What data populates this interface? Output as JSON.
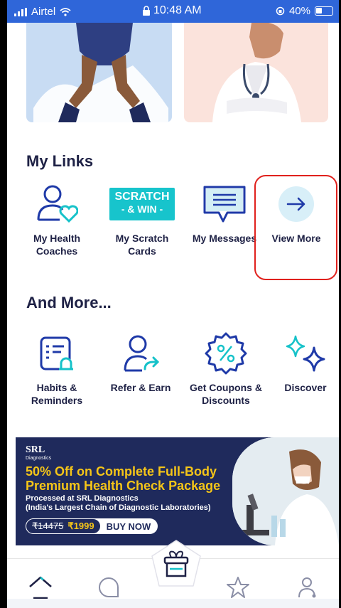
{
  "status_bar": {
    "carrier": "Airtel",
    "time": "10:48 AM",
    "battery": "40%"
  },
  "my_links": {
    "title": "My Links",
    "items": [
      {
        "label": "My Health Coaches",
        "icon": "person-heart-icon"
      },
      {
        "label": "My Scratch Cards",
        "icon": "scratch-win-icon",
        "badge_line1": "SCRATCH",
        "badge_line2": "- & WIN -"
      },
      {
        "label": "My Messages",
        "icon": "message-icon"
      },
      {
        "label": "View More",
        "icon": "arrow-right-icon"
      }
    ]
  },
  "and_more": {
    "title": "And More...",
    "items": [
      {
        "label": "Habits & Reminders",
        "icon": "habit-reminder-icon"
      },
      {
        "label": "Refer & Earn",
        "icon": "refer-user-icon"
      },
      {
        "label": "Get Coupons & Discounts",
        "icon": "coupon-percent-icon"
      },
      {
        "label": "Discover",
        "icon": "sparkle-icon"
      }
    ]
  },
  "ad": {
    "brand": "SRL",
    "brand_sub": "Diagnostics",
    "headline": "50% Off on Complete Full-Body Premium Health Check Package",
    "sub1": "Processed at SRL Diagnostics",
    "sub2": "(India's Largest Chain of Diagnostic Laboratories)",
    "old_price": "₹14475",
    "new_price": "₹1999",
    "cta": "BUY NOW"
  },
  "bottom_nav": [
    "home-icon",
    "chat-icon",
    "gift-box-icon",
    "stars-icon",
    "profile-icon"
  ],
  "colors": {
    "brand_blue": "#2f66d9",
    "dark_text": "#1e2145",
    "accent_teal": "#16c2c9",
    "highlight_red": "#e0211d"
  }
}
